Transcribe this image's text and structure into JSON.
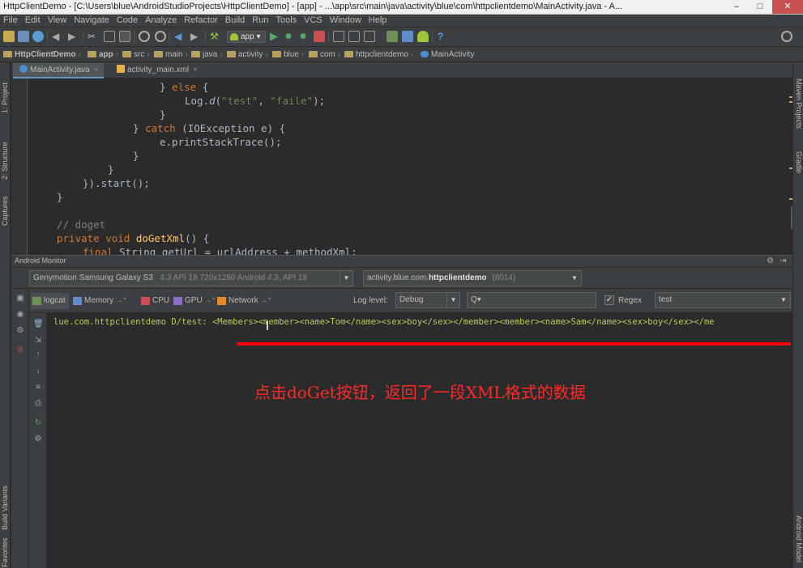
{
  "window": {
    "title": "HttpClientDemo - [C:\\Users\\blue\\AndroidStudioProjects\\HttpClientDemo] - [app] - ...\\app\\src\\main\\java\\activity\\blue\\com\\httpclientdemo\\MainActivity.java - A...",
    "minimize": "–",
    "maximize": "□",
    "close": "✕"
  },
  "menu": [
    "File",
    "Edit",
    "View",
    "Navigate",
    "Code",
    "Analyze",
    "Refactor",
    "Build",
    "Run",
    "Tools",
    "VCS",
    "Window",
    "Help"
  ],
  "toolbar": {
    "run_config": "app",
    "dropdown": "▾",
    "help": "?"
  },
  "breadcrumbs": [
    {
      "label": "HttpClientDemo",
      "icon": "project-icon"
    },
    {
      "label": "app",
      "icon": "folder-icon"
    },
    {
      "label": "src",
      "icon": "folder-icon"
    },
    {
      "label": "main",
      "icon": "folder-icon"
    },
    {
      "label": "java",
      "icon": "folder-icon"
    },
    {
      "label": "activity",
      "icon": "folder-icon"
    },
    {
      "label": "blue",
      "icon": "folder-icon"
    },
    {
      "label": "com",
      "icon": "folder-icon"
    },
    {
      "label": "httpclientdemo",
      "icon": "folder-icon"
    },
    {
      "label": "MainActivity",
      "icon": "class-icon"
    }
  ],
  "left_tool_tabs": [
    "1: Project",
    "2: Structure",
    "Captures",
    "Build Variants",
    "Favorites"
  ],
  "right_tool_tabs": [
    "Maven Projects",
    "Gradle",
    "Android Model"
  ],
  "editor_tabs": [
    {
      "label": "MainActivity.java",
      "close": "×"
    },
    {
      "label": "activity_main.xml",
      "close": "×"
    }
  ],
  "code": {
    "l1_brace": "} ",
    "l1_else": "else",
    "l1_open": " {",
    "l2_a": "Log.",
    "l2_d": "d",
    "l2_b": "(",
    "l2_s1": "\"test\"",
    "l2_c": ", ",
    "l2_s2": "\"faile\"",
    "l2_e": ");",
    "l3": "}",
    "l4_brace": "} ",
    "l4_catch": "catch",
    "l4_rest": " (IOException e) {",
    "l5": "e.printStackTrace();",
    "l6": "}",
    "l7": "}",
    "l8": "}).start();",
    "l9": "}",
    "l10": "// doget",
    "l11_private": "private ",
    "l11_void": "void ",
    "l11_fn": "doGetXml",
    "l11_rest": "() {",
    "l12_final": "final ",
    "l12_rest": "String getUrl = urlAddress + methodXml;"
  },
  "android_monitor": {
    "title": "Android Monitor",
    "device": "Genymotion Samsung Galaxy S3 4.3 API 18 720x1280 Android 4.3, API 18",
    "device_name": "Genymotion Samsung Galaxy S3",
    "device_detail": "4.3   API 18   720x1280 Android 4.3, API 18",
    "process_prefix": "activity.blue.com.",
    "process_bold": "httpclientdemo",
    "process_pid": "(8014)",
    "tabs": [
      {
        "label": "logcat",
        "pin": ""
      },
      {
        "label": "Memory",
        "pin": "→*"
      },
      {
        "label": "CPU",
        "pin": "→*"
      },
      {
        "label": "GPU",
        "pin": "→*"
      },
      {
        "label": "Network",
        "pin": "→*"
      }
    ],
    "log_level_label": "Log level:",
    "log_level_value": "Debug",
    "search_placeholder": "Q▾",
    "regex_label": "Regex",
    "regex_checked": "✓",
    "filter_value": "test",
    "log_line": "lue.com.httpclientdemo D/test: <Members><member><name>Tom</name><sex>boy</sex></member><member><name>Sam</name><sex>boy</sex></me"
  },
  "annotation": "点击doGet按钮，返回了一段XML格式的数据",
  "colors": {
    "annotation": "#ff2a2a",
    "underline": "#ff0000",
    "log_text": "#b9c95c"
  }
}
